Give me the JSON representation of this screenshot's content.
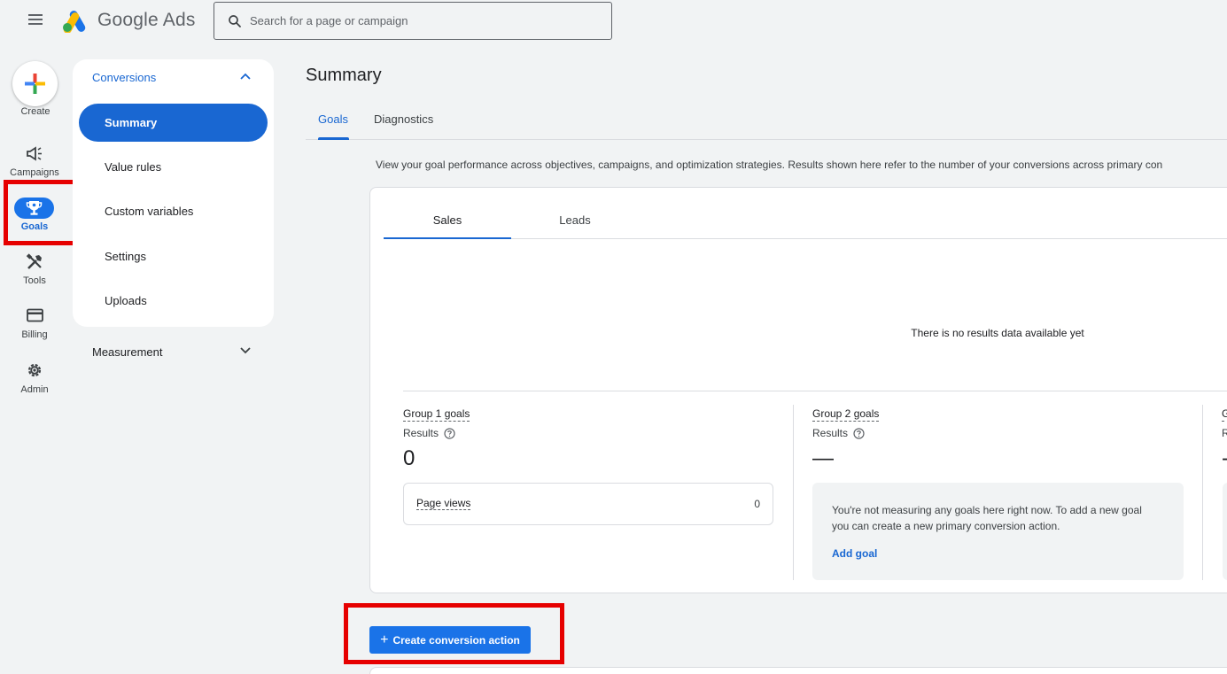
{
  "header": {
    "brand": "Google Ads",
    "search_placeholder": "Search for a page or campaign"
  },
  "rail": {
    "create_label": "Create",
    "items": [
      {
        "label": "Campaigns",
        "icon": "megaphone-icon"
      },
      {
        "label": "Goals",
        "icon": "trophy-icon"
      },
      {
        "label": "Tools",
        "icon": "tools-icon"
      },
      {
        "label": "Billing",
        "icon": "credit-card-icon"
      },
      {
        "label": "Admin",
        "icon": "gear-icon"
      }
    ]
  },
  "sidenav": {
    "section": "Conversions",
    "items": [
      "Summary",
      "Value rules",
      "Custom variables",
      "Settings",
      "Uploads"
    ],
    "active": "Summary",
    "measurement": "Measurement"
  },
  "main": {
    "title": "Summary",
    "tabs": [
      "Goals",
      "Diagnostics"
    ],
    "description": "View your goal performance across objectives, campaigns, and optimization strategies. Results shown here refer to the number of your conversions across primary con",
    "card": {
      "tabs": [
        "Sales",
        "Leads"
      ],
      "no_data": "There is no results data available yet",
      "groups": [
        {
          "title": "Group 1 goals",
          "results_label": "Results",
          "value": "0"
        },
        {
          "title": "Group 2 goals",
          "results_label": "Results",
          "value": "—"
        }
      ],
      "page_views": {
        "label": "Page views",
        "value": "0"
      },
      "empty_message": "You're not measuring any goals here right now. To add a new goal you can create a new primary conversion action.",
      "add_goal": "Add goal",
      "partial_group_char": "G",
      "partial_results_char": "R",
      "partial_value_char": "-"
    },
    "create_action": "Create conversion action"
  },
  "colors": {
    "accent": "#1a73e8",
    "highlight": "#e60000"
  }
}
